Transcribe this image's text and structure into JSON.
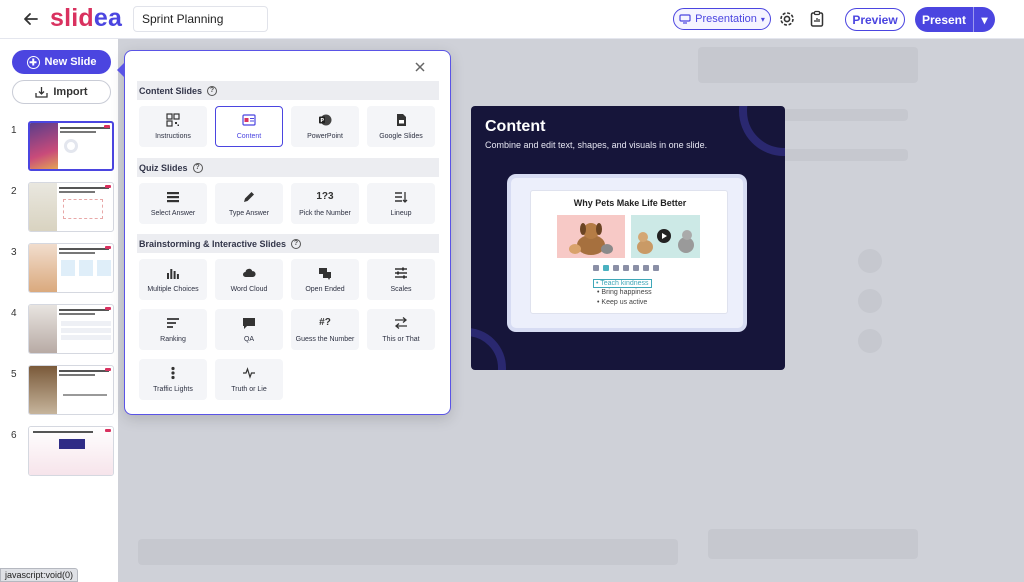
{
  "header": {
    "logo_part1": "slid",
    "logo_part2": "ea",
    "presentation_title": "Sprint Planning",
    "mode": "Presentation",
    "preview_label": "Preview",
    "present_label": "Present"
  },
  "sidebar": {
    "new_slide_label": "New Slide",
    "import_label": "Import",
    "slides": [
      {
        "number": "1"
      },
      {
        "number": "2"
      },
      {
        "number": "3"
      },
      {
        "number": "4"
      },
      {
        "number": "5"
      },
      {
        "number": "6"
      }
    ]
  },
  "picker": {
    "sections": [
      {
        "title": "Content Slides",
        "items": [
          "Instructions",
          "Content",
          "PowerPoint",
          "Google Slides"
        ]
      },
      {
        "title": "Quiz Slides",
        "items": [
          "Select Answer",
          "Type Answer",
          "Pick the Number",
          "Lineup"
        ]
      },
      {
        "title": "Brainstorming & Interactive Slides",
        "items": [
          "Multiple Choices",
          "Word Cloud",
          "Open Ended",
          "Scales",
          "Ranking",
          "QA",
          "Guess the Number",
          "This or That",
          "Traffic Lights",
          "Truth or Lie"
        ]
      }
    ],
    "selected": "Content",
    "icon_text": {
      "pick_number": "1?3",
      "guess_number": "#?"
    }
  },
  "preview": {
    "title": "Content",
    "subtitle": "Combine and edit text, shapes, and visuals in one slide.",
    "mock_title": "Why Pets Make Life Better",
    "bullets": [
      "Teach kindness",
      "Bring happiness",
      "Keep us active"
    ]
  },
  "status_url": "javascript:void(0)",
  "colors": {
    "brand_primary": "#4b45e0",
    "brand_pink": "#d9315f",
    "preview_bg": "#16153a"
  }
}
